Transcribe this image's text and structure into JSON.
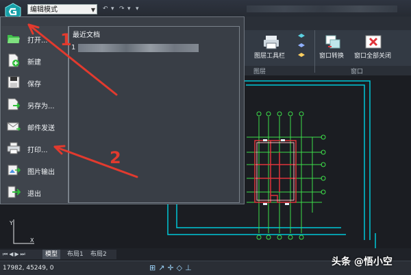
{
  "titlebar": {
    "mode_value": "编辑模式"
  },
  "menu": {
    "items": [
      {
        "label": "打开...",
        "icon": "folder-open-icon"
      },
      {
        "label": "新建",
        "icon": "new-document-icon"
      },
      {
        "label": "保存",
        "icon": "save-icon"
      },
      {
        "label": "另存为...",
        "icon": "save-as-icon"
      },
      {
        "label": "邮件发送",
        "icon": "email-icon"
      },
      {
        "label": "打印...",
        "icon": "printer-icon"
      },
      {
        "label": "图片输出",
        "icon": "image-export-icon"
      },
      {
        "label": "退出",
        "icon": "exit-icon"
      }
    ],
    "recent_title": "最近文档",
    "recent_item_index": "1"
  },
  "ribbon": {
    "layer_toolbar": "图层工具栏",
    "window_switch": "窗口转换",
    "close_all": "窗口全部关闭",
    "group_layers": "图层",
    "group_window": "窗口"
  },
  "tabs": [
    "模型",
    "布局1",
    "布局2"
  ],
  "status": {
    "coords": "17982, 45249, 0"
  },
  "annotations": {
    "arrow1": "1",
    "arrow2": "2"
  },
  "watermark": "头条 @悟小空",
  "colors": {
    "accent": "#00c8d8",
    "arrow": "#e23a2e",
    "plan_green": "#3ee04a",
    "plan_red": "#e0343a"
  }
}
